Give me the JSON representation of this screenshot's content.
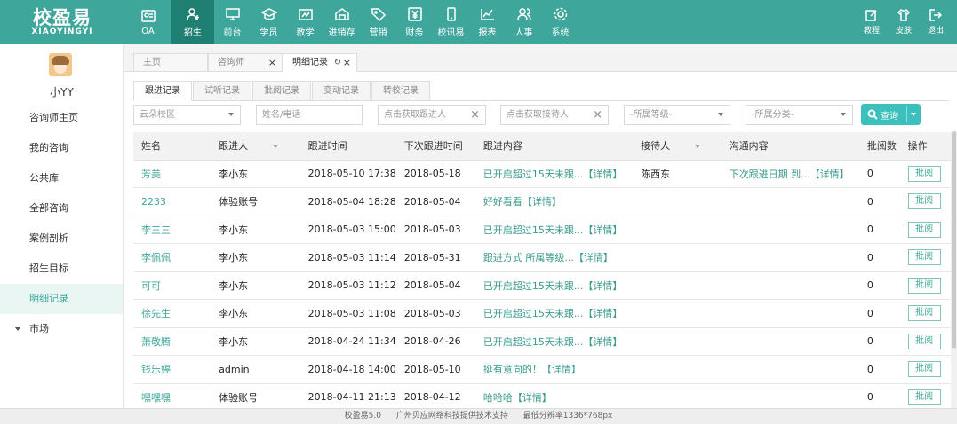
{
  "brand": {
    "name_cn": "校盈易",
    "name_en": "XIAOYINGYI"
  },
  "topnav": [
    {
      "label": "OA",
      "icon": "id-card-icon"
    },
    {
      "label": "招生",
      "icon": "recruit-icon"
    },
    {
      "label": "前台",
      "icon": "monitor-icon"
    },
    {
      "label": "学员",
      "icon": "graduation-cap-icon"
    },
    {
      "label": "教学",
      "icon": "teaching-icon"
    },
    {
      "label": "进销存",
      "icon": "warehouse-icon"
    },
    {
      "label": "营销",
      "icon": "tag-icon"
    },
    {
      "label": "财务",
      "icon": "yuan-icon"
    },
    {
      "label": "校讯易",
      "icon": "phone-icon"
    },
    {
      "label": "报表",
      "icon": "chart-icon"
    },
    {
      "label": "人事",
      "icon": "people-icon"
    },
    {
      "label": "系统",
      "icon": "gear-icon"
    }
  ],
  "rightnav": [
    {
      "label": "教程",
      "icon": "edit-icon"
    },
    {
      "label": "皮肤",
      "icon": "shirt-icon"
    },
    {
      "label": "退出",
      "icon": "logout-icon"
    }
  ],
  "user": {
    "name": "小YY"
  },
  "sidebar": {
    "items": [
      {
        "label": "咨询师主页"
      },
      {
        "label": "我的咨询"
      },
      {
        "label": "公共库"
      },
      {
        "label": "全部咨询"
      },
      {
        "label": "案例剖析"
      },
      {
        "label": "招生目标"
      },
      {
        "label": "明细记录"
      },
      {
        "label": "市场"
      }
    ]
  },
  "pagetabs": [
    {
      "label": "主页"
    },
    {
      "label": "咨询师"
    },
    {
      "label": "明细记录"
    }
  ],
  "subtabs": [
    {
      "label": "跟进记录"
    },
    {
      "label": "试听记录"
    },
    {
      "label": "批阅记录"
    },
    {
      "label": "变动记录"
    },
    {
      "label": "转校记录"
    }
  ],
  "filters": {
    "campus": "云朵校区",
    "name_phone_placeholder": "姓名/电话",
    "follower_placeholder": "点击获取跟进人",
    "receiver_placeholder": "点击获取接待人",
    "level": "-所属等级-",
    "category": "-所属分类-",
    "search_label": "查询"
  },
  "table": {
    "headers": [
      "姓名",
      "跟进人",
      "跟进时间",
      "下次跟进时间",
      "跟进内容",
      "接待人",
      "沟通内容",
      "批阅数",
      "操作"
    ],
    "action_label": "批阅",
    "rows": [
      {
        "name": "芳美",
        "follower": "李小东",
        "time": "2018-05-10 17:38",
        "next": "2018-05-18",
        "content": "已开启超过15天未跟...【详情】",
        "receiver": "陈西东",
        "comm": "下次跟进日期 到...【详情】",
        "count": "0"
      },
      {
        "name": "2233",
        "follower": "体验账号",
        "time": "2018-05-04 18:28",
        "next": "2018-05-04",
        "content": "好好看看【详情】",
        "receiver": "",
        "comm": "",
        "count": "0"
      },
      {
        "name": "李三三",
        "follower": "李小东",
        "time": "2018-05-03 15:00",
        "next": "2018-05-03",
        "content": "已开启超过15天未跟...【详情】",
        "receiver": "",
        "comm": "",
        "count": "0"
      },
      {
        "name": "李佩佩",
        "follower": "李小东",
        "time": "2018-05-03 11:14",
        "next": "2018-05-31",
        "content": "跟进方式 所属等级...【详情】",
        "receiver": "",
        "comm": "",
        "count": "0"
      },
      {
        "name": "可可",
        "follower": "李小东",
        "time": "2018-05-03 11:12",
        "next": "2018-05-04",
        "content": "已开启超过15天未跟...【详情】",
        "receiver": "",
        "comm": "",
        "count": "0"
      },
      {
        "name": "徐先生",
        "follower": "李小东",
        "time": "2018-05-03 11:08",
        "next": "2018-05-03",
        "content": "已开启超过15天未跟...【详情】",
        "receiver": "",
        "comm": "",
        "count": "0"
      },
      {
        "name": "萧敬腾",
        "follower": "李小东",
        "time": "2018-04-24 11:34",
        "next": "2018-04-26",
        "content": "已开启超过15天未跟...【详情】",
        "receiver": "",
        "comm": "",
        "count": "0"
      },
      {
        "name": "钱乐婷",
        "follower": "admin",
        "time": "2018-04-18 14:00",
        "next": "2018-05-10",
        "content": "挺有意向的！【详情】",
        "receiver": "",
        "comm": "",
        "count": "0"
      },
      {
        "name": "嘿嘿嘿",
        "follower": "体验账号",
        "time": "2018-04-11 21:13",
        "next": "2018-04-12",
        "content": "哈哈哈【详情】",
        "receiver": "",
        "comm": "",
        "count": "0"
      }
    ]
  },
  "footer": {
    "version": "校盈易5.0",
    "support": "广州贝应网络科技提供技术支持",
    "resolution": "最低分辨率1336*768px"
  },
  "colors": {
    "primary": "#3fa69b",
    "active_nav": "#1f7f73",
    "search_button": "#3cc0bd"
  }
}
